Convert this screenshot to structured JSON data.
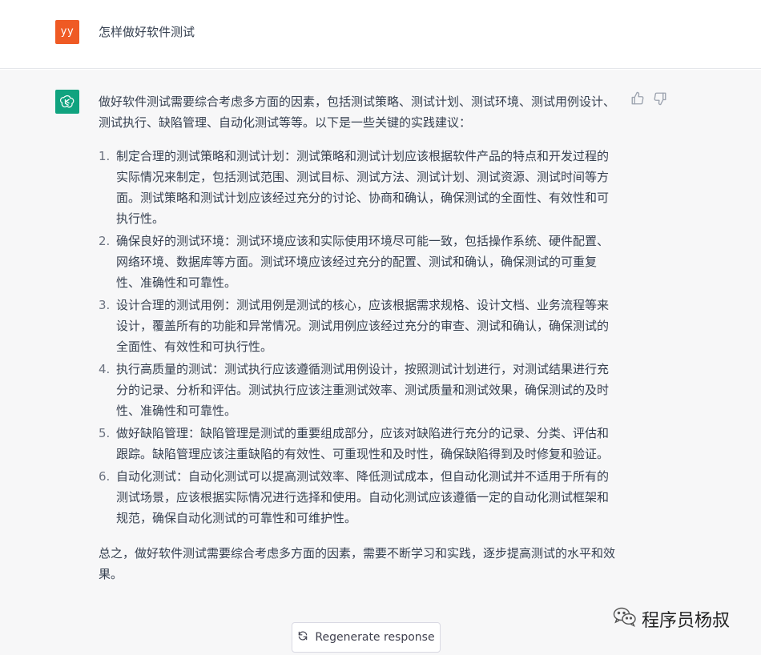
{
  "user": {
    "avatar": "yy",
    "message": "怎样做好软件测试"
  },
  "assistant": {
    "intro": "做好软件测试需要综合考虑多方面的因素，包括测试策略、测试计划、测试环境、测试用例设计、测试执行、缺陷管理、自动化测试等等。以下是一些关键的实践建议：",
    "items": [
      {
        "num": "1.",
        "text": "制定合理的测试策略和测试计划：测试策略和测试计划应该根据软件产品的特点和开发过程的实际情况来制定，包括测试范围、测试目标、测试方法、测试计划、测试资源、测试时间等方面。测试策略和测试计划应该经过充分的讨论、协商和确认，确保测试的全面性、有效性和可执行性。"
      },
      {
        "num": "2.",
        "text": "确保良好的测试环境：测试环境应该和实际使用环境尽可能一致，包括操作系统、硬件配置、网络环境、数据库等方面。测试环境应该经过充分的配置、测试和确认，确保测试的可重复性、准确性和可靠性。"
      },
      {
        "num": "3.",
        "text": "设计合理的测试用例：测试用例是测试的核心，应该根据需求规格、设计文档、业务流程等来设计，覆盖所有的功能和异常情况。测试用例应该经过充分的审查、测试和确认，确保测试的全面性、有效性和可执行性。"
      },
      {
        "num": "4.",
        "text": "执行高质量的测试：测试执行应该遵循测试用例设计，按照测试计划进行，对测试结果进行充分的记录、分析和评估。测试执行应该注重测试效率、测试质量和测试效果，确保测试的及时性、准确性和可靠性。"
      },
      {
        "num": "5.",
        "text": "做好缺陷管理：缺陷管理是测试的重要组成部分，应该对缺陷进行充分的记录、分类、评估和跟踪。缺陷管理应该注重缺陷的有效性、可重现性和及时性，确保缺陷得到及时修复和验证。"
      },
      {
        "num": "6.",
        "text": "自动化测试：自动化测试可以提高测试效率、降低测试成本，但自动化测试并不适用于所有的测试场景，应该根据实际情况进行选择和使用。自动化测试应该遵循一定的自动化测试框架和规范，确保自动化测试的可靠性和可维护性。"
      }
    ],
    "conclusion": "总之，做好软件测试需要综合考虑多方面的因素，需要不断学习和实践，逐步提高测试的水平和效果。"
  },
  "actions": {
    "regenerate_label": "Regenerate response",
    "regenerate_icon": "refresh-icon",
    "thumbs_up_icon": "thumbs-up-icon",
    "thumbs_down_icon": "thumbs-down-icon"
  },
  "watermark": {
    "text": "程序员杨叔"
  },
  "colors": {
    "user_avatar_bg": "#ef5a24",
    "bot_avatar_bg": "#10a37f",
    "assistant_bg": "#f7f7f8"
  }
}
